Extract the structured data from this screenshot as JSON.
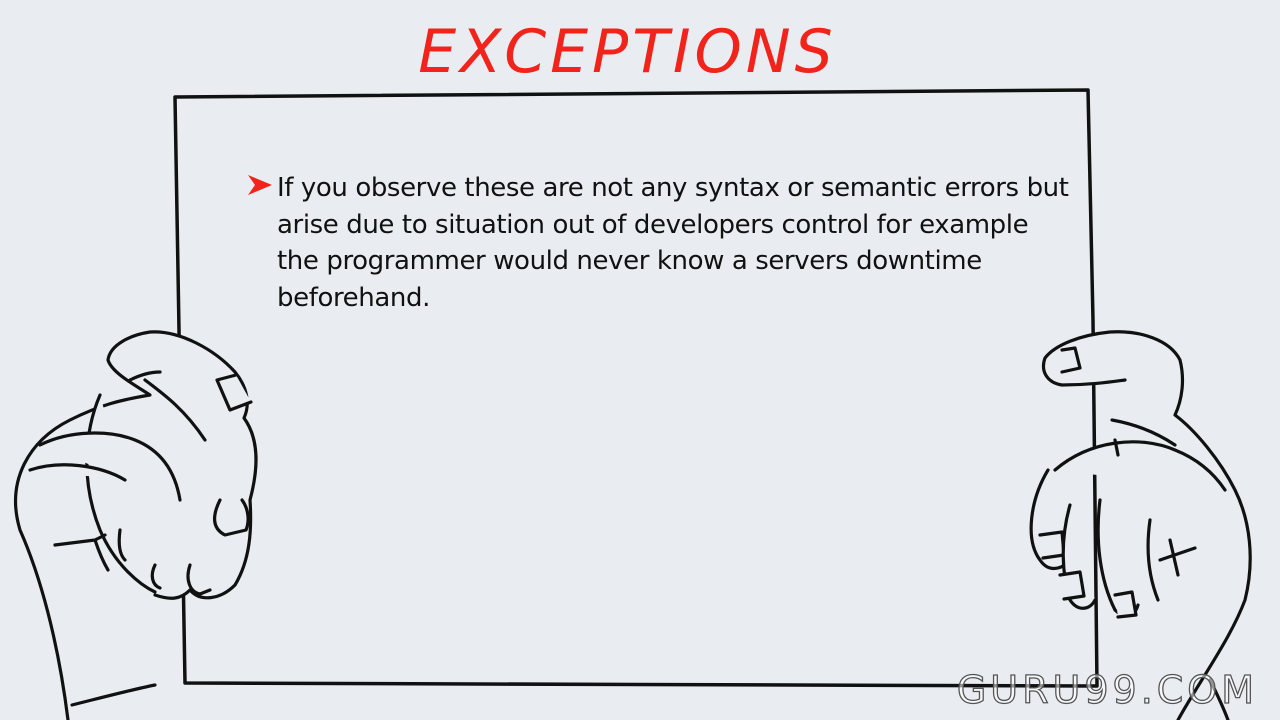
{
  "slide": {
    "title": "EXCEPTIONS",
    "bullet_text": "If you observe these are not any syntax or semantic errors but arise due to situation out of developers control for example the programmer would never know a servers downtime beforehand.",
    "bullet_icon": "red-arrow-bullet-icon",
    "watermark": "GURU99.COM"
  },
  "colors": {
    "background": "#e9edf1",
    "title": "#f2231a",
    "bullet": "#f2231a",
    "text": "#111111",
    "outline": "#111111"
  }
}
